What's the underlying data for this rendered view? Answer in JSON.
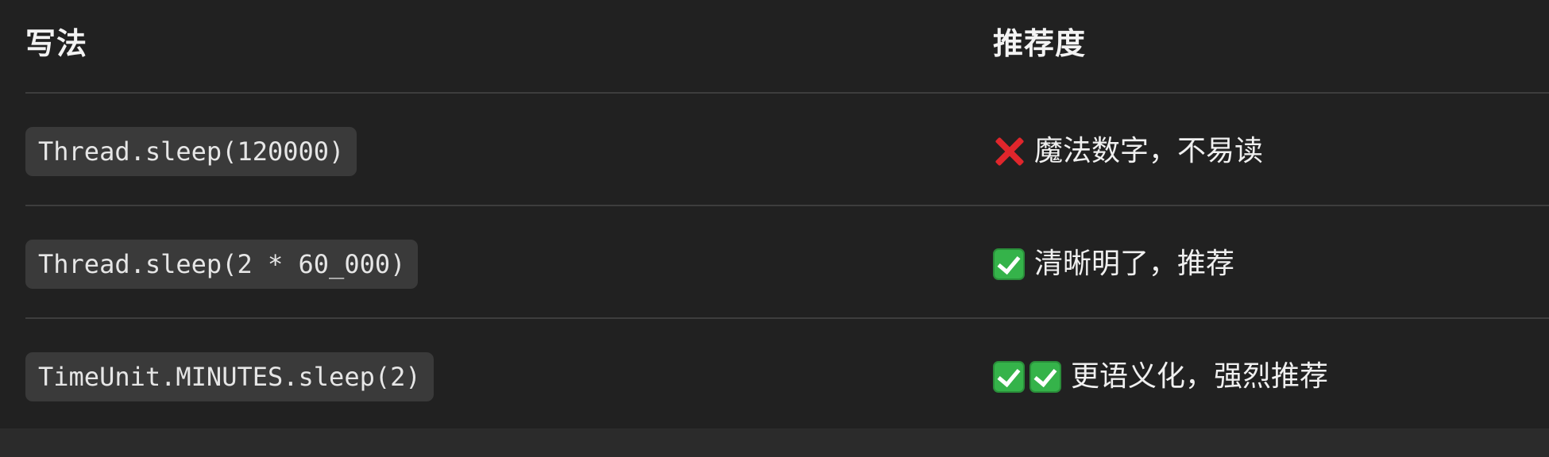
{
  "table": {
    "headers": {
      "col1": "写法",
      "col2": "推荐度"
    },
    "rows": [
      {
        "code": "Thread.sleep(120000)",
        "marks": [
          "cross-icon"
        ],
        "rating_text": "魔法数字，不易读"
      },
      {
        "code": "Thread.sleep(2 * 60_000)",
        "marks": [
          "check-icon"
        ],
        "rating_text": "清晰明了，推荐"
      },
      {
        "code": "TimeUnit.MINUTES.sleep(2)",
        "marks": [
          "check-icon",
          "check-icon"
        ],
        "rating_text": "更语义化，强烈推荐"
      }
    ]
  },
  "colors": {
    "background": "#212121",
    "code_background": "#3a3a3a",
    "divider": "#3d3d3d",
    "check_green": "#35b34a",
    "cross_red": "#e0262c"
  }
}
